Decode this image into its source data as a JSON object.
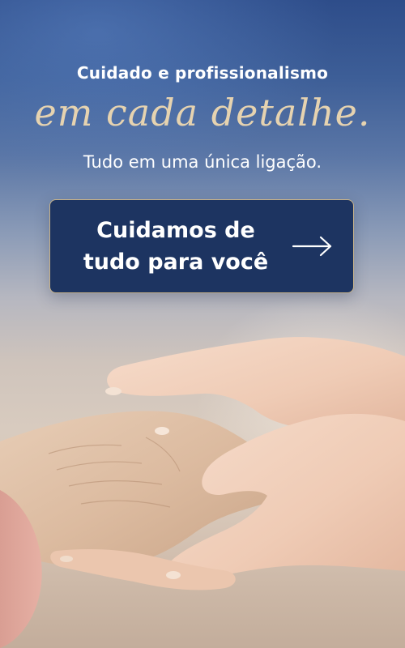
{
  "banner": {
    "headline_top": "Cuidado e profissionalismo",
    "headline_script": "em cada detalhe.",
    "subheadline": "Tudo em uma única ligação.",
    "cta": {
      "line1": "Cuidamos de",
      "line2": "tudo para você",
      "icon": "arrow-right-icon"
    },
    "photo": {
      "subject": "hands-holding-photo"
    },
    "colors": {
      "navy_button": "#1d3461",
      "gold_accent": "#e6d3b0",
      "button_border": "#c9b48a",
      "sky_blue": "#2e4d8a"
    }
  }
}
